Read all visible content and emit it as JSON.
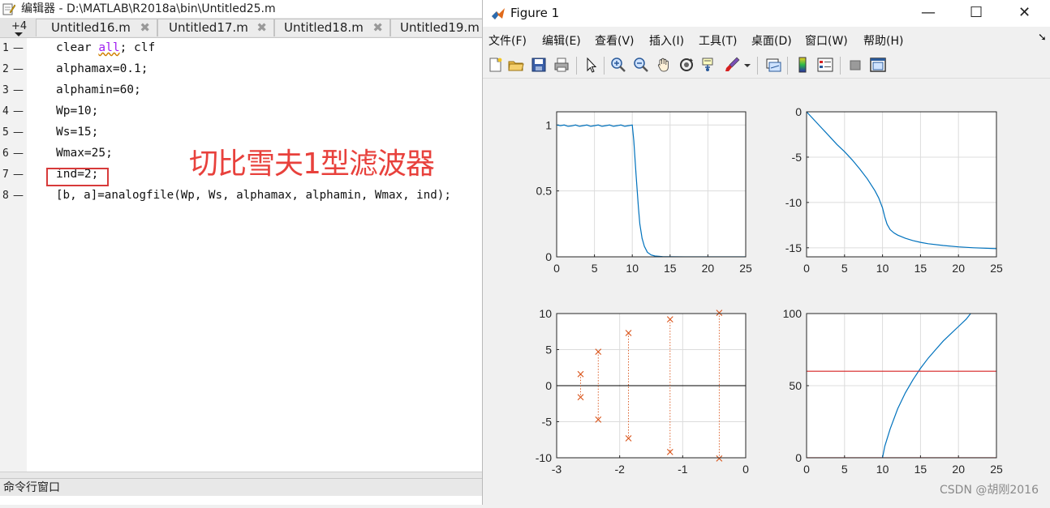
{
  "editor": {
    "title": "编辑器 - D:\\MATLAB\\R2018a\\bin\\Untitled25.m",
    "tab_count_label": "+4",
    "tabs": [
      {
        "label": "Untitled16.m",
        "close": "✖"
      },
      {
        "label": "Untitled17.m",
        "close": "✖"
      },
      {
        "label": "Untitled18.m",
        "close": "✖"
      },
      {
        "label": "Untitled19.m",
        "close": ""
      }
    ],
    "line_dash": "—",
    "lines": [
      {
        "num": "1",
        "pre": "clear ",
        "kw": "all",
        "post": "; clf"
      },
      {
        "num": "2",
        "pre": "alphamax=0.1;",
        "kw": "",
        "post": ""
      },
      {
        "num": "3",
        "pre": "alphamin=60;",
        "kw": "",
        "post": ""
      },
      {
        "num": "4",
        "pre": "Wp=10;",
        "kw": "",
        "post": ""
      },
      {
        "num": "5",
        "pre": "Ws=15;",
        "kw": "",
        "post": ""
      },
      {
        "num": "6",
        "pre": "Wmax=25;",
        "kw": "",
        "post": ""
      },
      {
        "num": "7",
        "pre": "ind=2;",
        "kw": "",
        "post": ""
      },
      {
        "num": "8",
        "pre": "[b, a]=analogfile(Wp, Ws, alphamax, alphamin, Wmax, ind);",
        "kw": "",
        "post": ""
      }
    ],
    "annotation": "切比雪夫1型滤波器",
    "command_window_label": "命令行窗口"
  },
  "figure": {
    "title": "Figure 1",
    "window_controls": {
      "minimize": "—",
      "maximize": "☐",
      "close": "✕"
    },
    "menu": [
      "文件(F)",
      "编辑(E)",
      "查看(V)",
      "插入(I)",
      "工具(T)",
      "桌面(D)",
      "窗口(W)",
      "帮助(H)"
    ],
    "menu_overflow": "➘",
    "toolbar_icons": [
      "new-file-icon",
      "open-folder-icon",
      "save-icon",
      "print-icon",
      "pointer-icon",
      "zoom-in-icon",
      "zoom-out-icon",
      "pan-hand-icon",
      "rotate-3d-icon",
      "data-cursor-icon",
      "brush-icon",
      "link-plot-icon",
      "colorbar-icon",
      "legend-icon",
      "hide-tools-icon",
      "dock-icon"
    ],
    "watermark": "CSDN @胡刚2016"
  },
  "colors": {
    "line": "#0072bd",
    "marker": "#d95319",
    "red": "#d62020",
    "annot": "#e8413c",
    "box": "#d73a3a"
  },
  "chart_data": [
    {
      "type": "line",
      "xlim": [
        0,
        25
      ],
      "ylim": [
        0,
        1.1
      ],
      "xticks": [
        0,
        5,
        10,
        15,
        20,
        25
      ],
      "yticks": [
        0,
        0.5,
        1
      ],
      "xtick_labels": [
        "0",
        "5",
        "10",
        "15",
        "20",
        "25"
      ],
      "ytick_labels": [
        "0",
        "0.5",
        "1"
      ],
      "grid": true,
      "series": [
        {
          "color": "#0072bd",
          "x": [
            0,
            0.5,
            1,
            1.5,
            2,
            2.5,
            3,
            3.5,
            4,
            4.5,
            5,
            5.5,
            6,
            6.5,
            7,
            7.5,
            8,
            8.5,
            9,
            9.5,
            10,
            10.2,
            10.5,
            10.8,
            11,
            11.3,
            11.6,
            12,
            12.5,
            13,
            14,
            15,
            17,
            20,
            25
          ],
          "y": [
            1,
            0.995,
            1.0,
            0.99,
            0.993,
            1.0,
            0.99,
            0.995,
            1.0,
            0.99,
            0.995,
            1.0,
            0.99,
            0.995,
            1.0,
            0.99,
            0.995,
            1.0,
            0.99,
            0.995,
            1.0,
            0.88,
            0.62,
            0.38,
            0.25,
            0.14,
            0.08,
            0.035,
            0.014,
            0.006,
            0.002,
            0.001,
            0,
            0,
            0
          ]
        }
      ]
    },
    {
      "type": "line",
      "xlim": [
        0,
        25
      ],
      "ylim": [
        -16,
        0
      ],
      "xticks": [
        0,
        5,
        10,
        15,
        20,
        25
      ],
      "yticks": [
        -15,
        -10,
        -5,
        0
      ],
      "xtick_labels": [
        "0",
        "5",
        "10",
        "15",
        "20",
        "25"
      ],
      "ytick_labels": [
        "-15",
        "-10",
        "-5",
        "0"
      ],
      "grid": true,
      "series": [
        {
          "color": "#0072bd",
          "x": [
            0,
            1,
            2,
            3,
            4,
            5,
            6,
            7,
            8,
            9,
            9.5,
            10,
            10.3,
            10.6,
            11,
            11.5,
            12,
            13,
            14,
            15,
            16,
            18,
            20,
            22,
            25
          ],
          "y": [
            0,
            -0.9,
            -1.8,
            -2.7,
            -3.6,
            -4.4,
            -5.3,
            -6.3,
            -7.4,
            -8.7,
            -9.5,
            -10.6,
            -11.6,
            -12.4,
            -13.0,
            -13.35,
            -13.6,
            -13.95,
            -14.2,
            -14.4,
            -14.55,
            -14.75,
            -14.9,
            -15.0,
            -15.1
          ]
        }
      ]
    },
    {
      "type": "scatter",
      "xlim": [
        -3,
        0
      ],
      "ylim": [
        -10,
        10
      ],
      "xticks": [
        -3,
        -2,
        -1,
        0
      ],
      "yticks": [
        -10,
        -5,
        0,
        5,
        10
      ],
      "xtick_labels": [
        "-3",
        "-2",
        "-1",
        "0"
      ],
      "ytick_labels": [
        "-10",
        "-5",
        "0",
        "5",
        "10"
      ],
      "grid": true,
      "points": [
        {
          "x": -2.62,
          "y": 1.6
        },
        {
          "x": -2.62,
          "y": -1.6
        },
        {
          "x": -2.34,
          "y": 4.7
        },
        {
          "x": -2.34,
          "y": -4.7
        },
        {
          "x": -1.86,
          "y": 7.3
        },
        {
          "x": -1.86,
          "y": -7.3
        },
        {
          "x": -1.2,
          "y": 9.2
        },
        {
          "x": -1.2,
          "y": -9.2
        },
        {
          "x": -0.42,
          "y": 10.1
        },
        {
          "x": -0.42,
          "y": -10.1
        }
      ]
    },
    {
      "type": "line",
      "xlim": [
        0,
        25
      ],
      "ylim": [
        0,
        100
      ],
      "xticks": [
        0,
        5,
        10,
        15,
        20,
        25
      ],
      "yticks": [
        0,
        50,
        100
      ],
      "xtick_labels": [
        "0",
        "5",
        "10",
        "15",
        "20",
        "25"
      ],
      "ytick_labels": [
        "0",
        "50",
        "100"
      ],
      "grid": true,
      "series": [
        {
          "color": "#0072bd",
          "x": [
            10,
            10.3,
            11,
            12,
            13,
            14,
            15,
            16,
            17,
            18,
            19,
            20,
            21,
            21.6
          ],
          "y": [
            0,
            8,
            20,
            34,
            45,
            54,
            62,
            69,
            75,
            81,
            86,
            91,
            96,
            100
          ]
        },
        {
          "color": "#d62020",
          "x": [
            0,
            25
          ],
          "y": [
            60,
            60
          ]
        },
        {
          "color": "#d62020",
          "x": [
            0,
            25
          ],
          "y": [
            0,
            0
          ]
        }
      ]
    }
  ]
}
